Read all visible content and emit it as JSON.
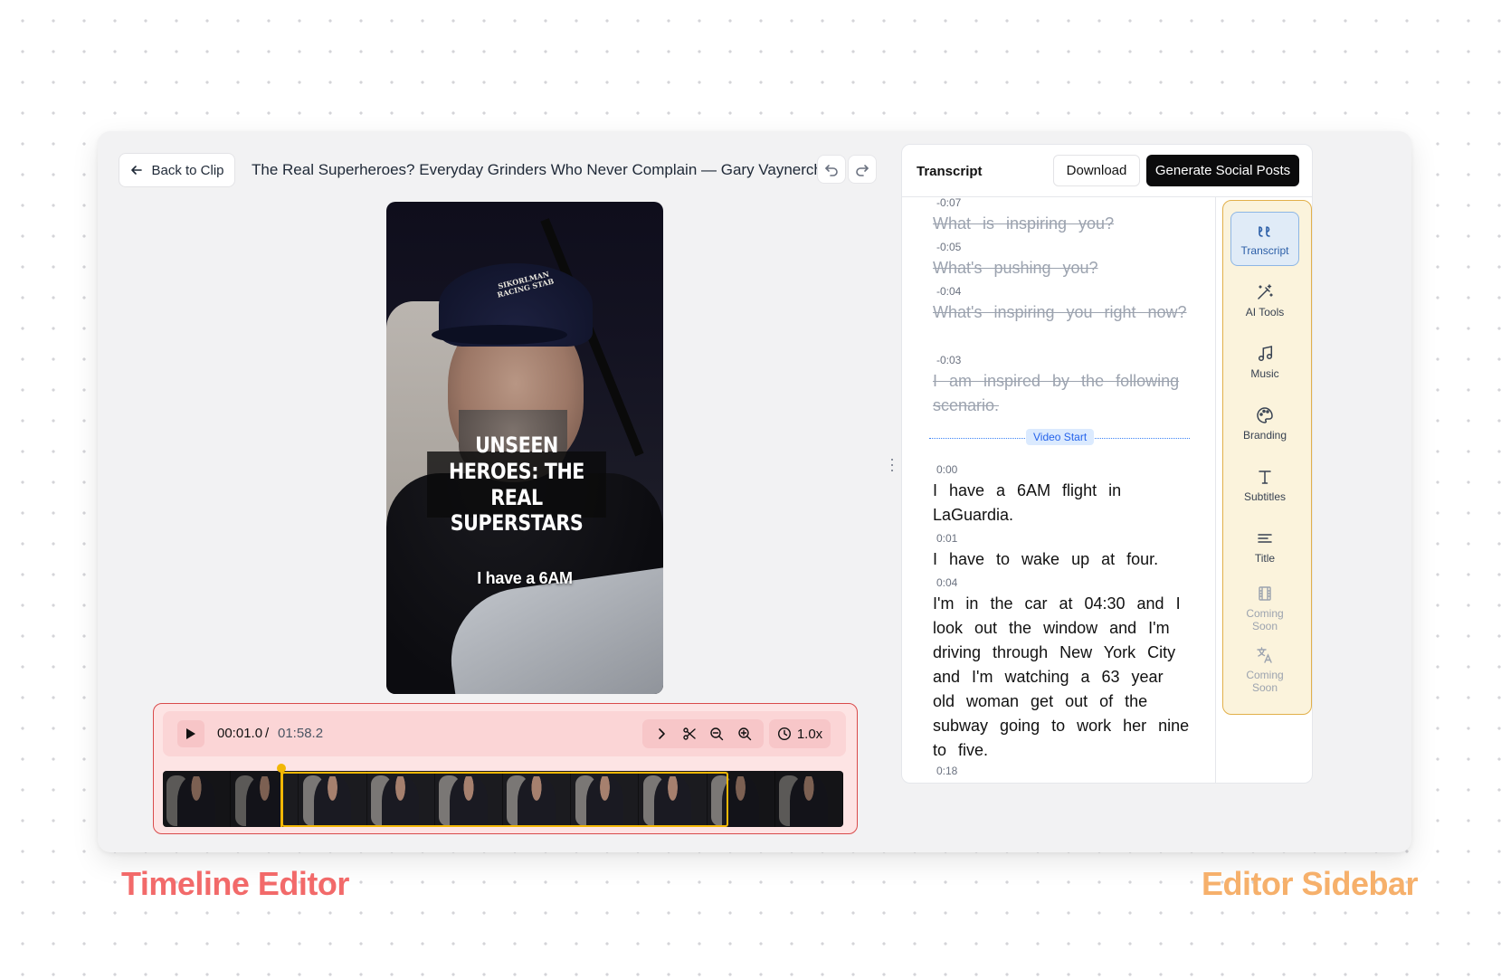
{
  "header": {
    "back_label": "Back to Clip",
    "clip_title": "The Real Superheroes? Everyday Grinders Who Never Complain — Gary Vaynerchuk"
  },
  "video": {
    "caption_title": "UNSEEN HEROES: THE REAL SUPERSTARS",
    "subtitle": "I have a 6AM",
    "cap_text": "SIKORLMAN RACING STAB"
  },
  "player": {
    "current_time": "00:01.0",
    "separator": "/",
    "total_time": "01:58.2",
    "speed": "1.0x",
    "filmstrip_frames": 10
  },
  "panel": {
    "title": "Transcript",
    "download_label": "Download",
    "generate_label": "Generate Social Posts",
    "video_start_label": "Video Start"
  },
  "transcript": {
    "deleted": [
      {
        "time": "-0:07",
        "text": "What is inspiring you?"
      },
      {
        "time": "-0:05",
        "text": "What's pushing you?"
      },
      {
        "time": "-0:04",
        "text": "What's inspiring you right now?"
      },
      {
        "time": "-0:03",
        "text": "I am inspired by the following scenario."
      }
    ],
    "active": [
      {
        "time": "0:00",
        "text": "I have a 6AM flight in LaGuardia."
      },
      {
        "time": "0:01",
        "text": "I have to wake up at four."
      },
      {
        "time": "0:04",
        "text": "I'm in the car at 04:30 and I look out the window and I'm driving through New York City and I'm watching a 63 year old woman get out of the subway going to work her nine to five."
      },
      {
        "time": "0:18",
        "text": ""
      }
    ]
  },
  "sidebar": {
    "items": [
      {
        "label": "Transcript",
        "icon": "quote-icon"
      },
      {
        "label": "AI Tools",
        "icon": "magic-wand-icon"
      },
      {
        "label": "Music",
        "icon": "music-note-icon"
      },
      {
        "label": "Branding",
        "icon": "palette-icon"
      },
      {
        "label": "Subtitles",
        "icon": "text-icon"
      },
      {
        "label": "Title",
        "icon": "align-icon"
      },
      {
        "label": "Coming Soon",
        "icon": "film-icon"
      },
      {
        "label": "Coming Soon",
        "icon": "translate-icon"
      }
    ]
  },
  "annotations": {
    "timeline_label": "Timeline Editor",
    "sidebar_label": "Editor Sidebar"
  },
  "colors": {
    "timeline_accent": "#d94b4b",
    "sidebar_accent": "#e2b04a",
    "playhead": "#f2b705",
    "active_tab": "#2b5ea7"
  }
}
